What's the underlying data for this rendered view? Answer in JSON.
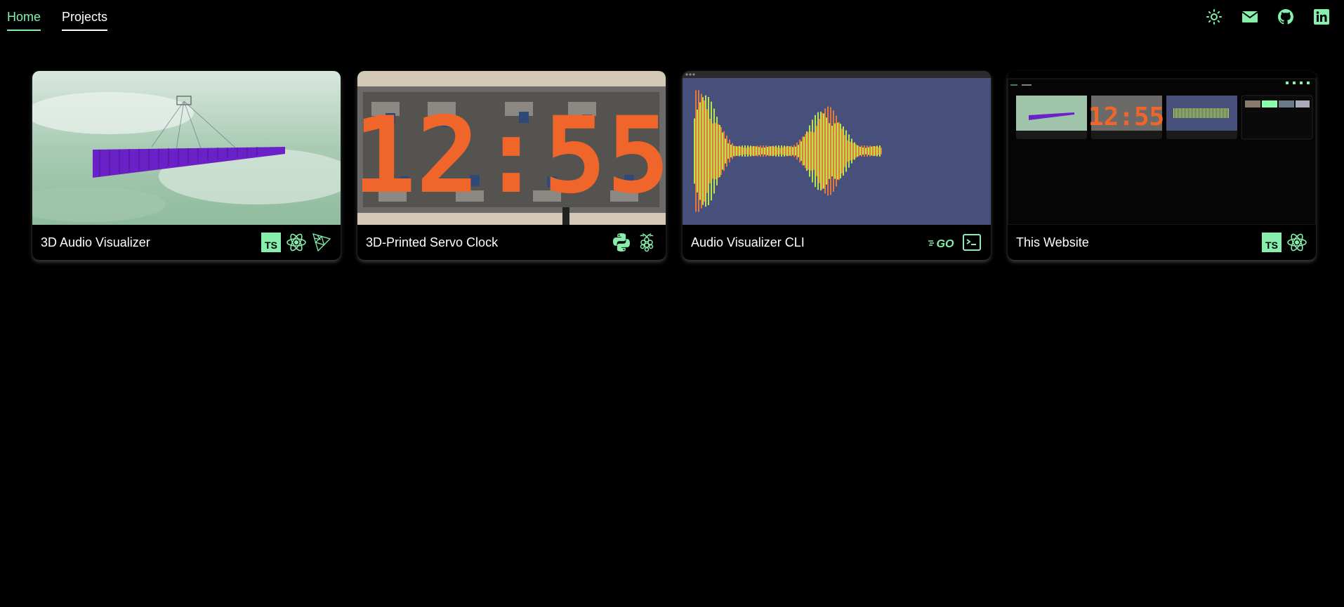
{
  "nav": {
    "home": "Home",
    "projects": "Projects"
  },
  "header_icons": [
    "sun-icon",
    "mail-icon",
    "github-icon",
    "linkedin-icon"
  ],
  "accent": "#86efac",
  "projects": [
    {
      "title": "3D Audio Visualizer",
      "badges": [
        "typescript-icon",
        "react-icon",
        "threejs-icon"
      ]
    },
    {
      "title": "3D-Printed Servo Clock",
      "badges": [
        "python-icon",
        "raspberry-pi-icon"
      ],
      "clock_text": "12:55"
    },
    {
      "title": "Audio Visualizer CLI",
      "badges": [
        "go-icon",
        "terminal-icon"
      ]
    },
    {
      "title": "This Website",
      "badges": [
        "typescript-icon",
        "react-icon"
      ]
    }
  ]
}
